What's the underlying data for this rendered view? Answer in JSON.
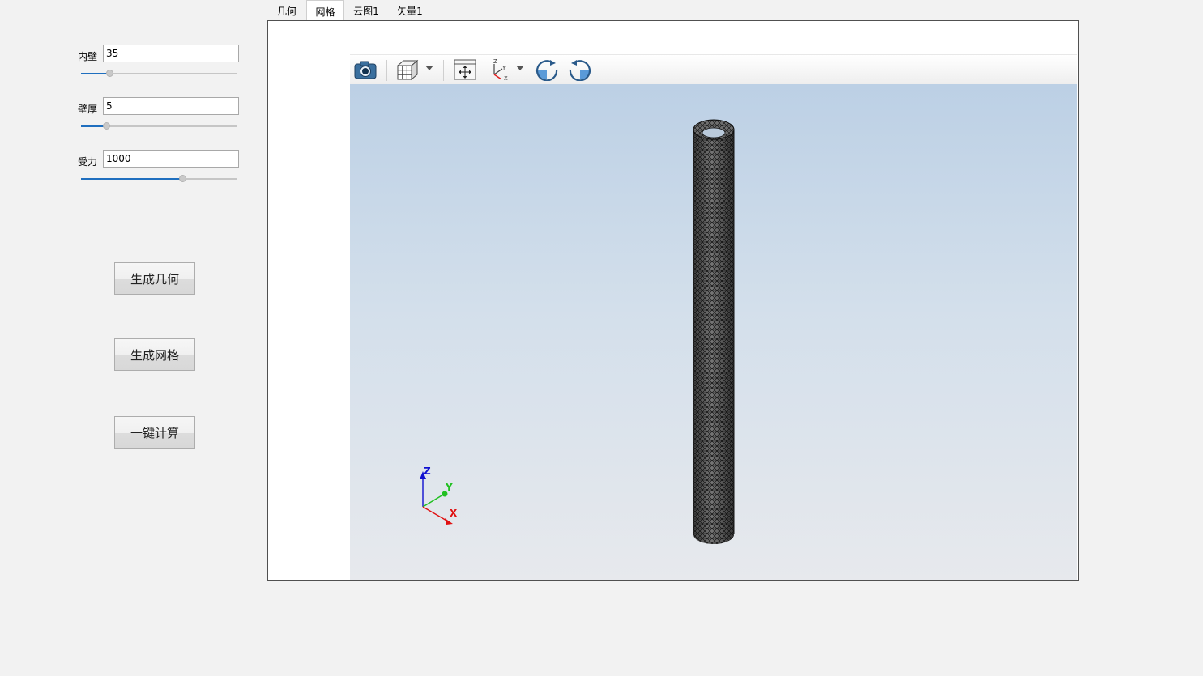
{
  "params": [
    {
      "label": "内壁",
      "value": "35",
      "slider_fraction": 0.18
    },
    {
      "label": "壁厚",
      "value": "5",
      "slider_fraction": 0.16
    },
    {
      "label": "受力",
      "value": "1000",
      "slider_fraction": 0.65
    }
  ],
  "actions": {
    "generate_geometry": "生成几何",
    "generate_mesh": "生成网格",
    "one_click_compute": "一键计算"
  },
  "tabs": [
    {
      "label": "几何",
      "active": false
    },
    {
      "label": "网格",
      "active": true
    },
    {
      "label": "云图1",
      "active": false
    },
    {
      "label": "矢量1",
      "active": false
    }
  ],
  "toolbar": {
    "icons": [
      "camera-icon",
      "view-cube-icon",
      "dropdown-arrow-icon",
      "fit-view-icon",
      "axes-view-icon",
      "dropdown-arrow-icon",
      "rotate-clockwise-icon",
      "rotate-counterclockwise-icon"
    ]
  },
  "triad": {
    "x": "X",
    "y": "Y",
    "z": "Z"
  },
  "toolbar_axes_icon": {
    "z": "Z",
    "y": "Y",
    "x": "X"
  },
  "colors": {
    "accent": "#1f6fbf",
    "axis_x": "#e01010",
    "axis_y": "#20c020",
    "axis_z": "#1010d0",
    "mesh": "#111111"
  }
}
